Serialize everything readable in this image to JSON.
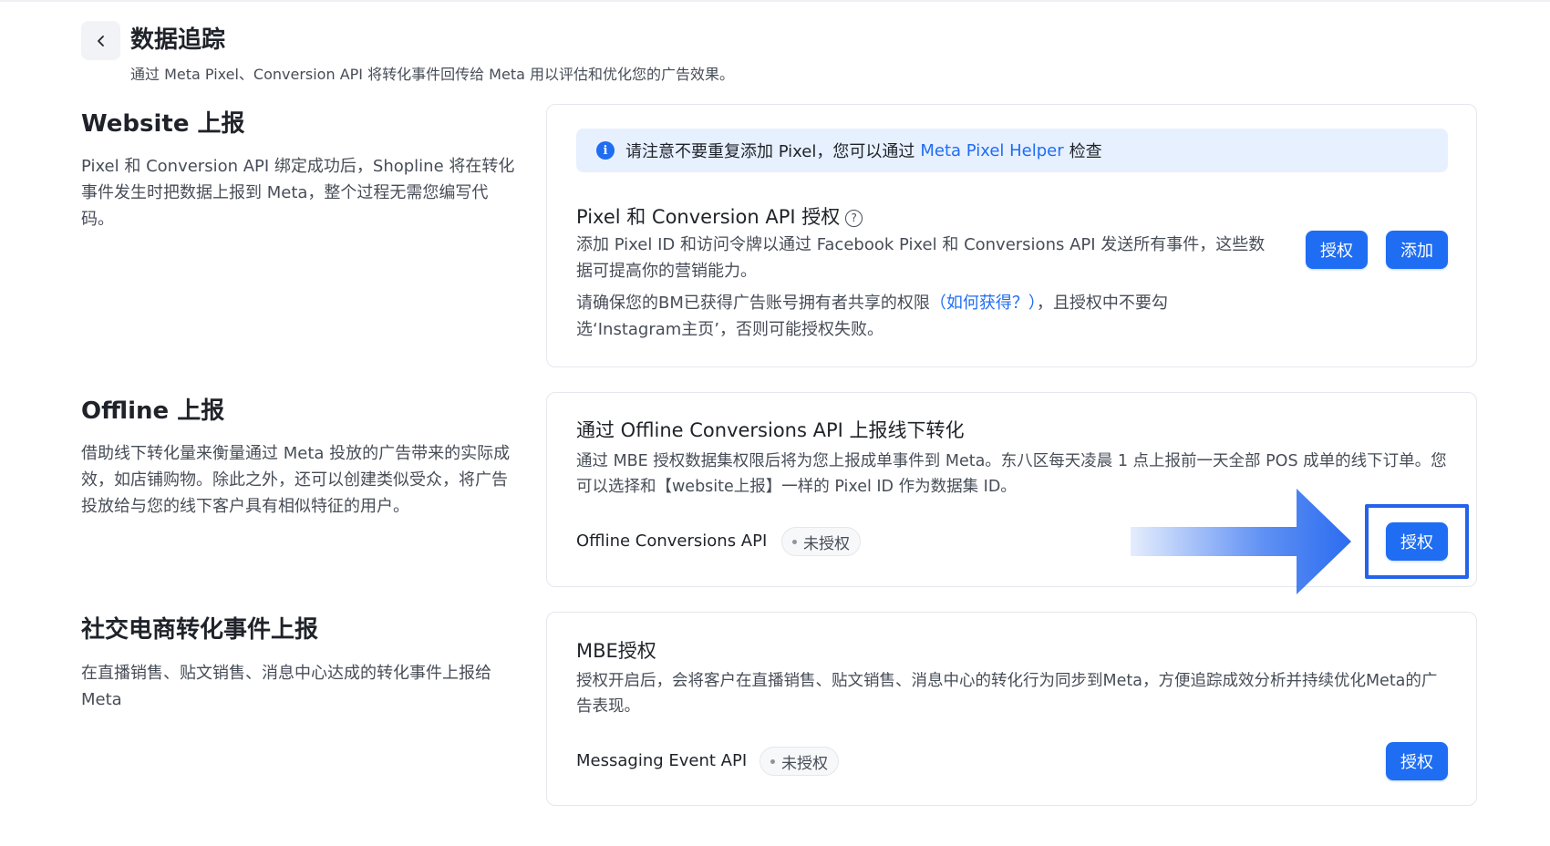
{
  "header": {
    "title": "数据追踪",
    "subtitle": "通过 Meta Pixel、Conversion API 将转化事件回传给 Meta 用以评估和优化您的广告效果。"
  },
  "website": {
    "title": "Website 上报",
    "description": "Pixel 和 Conversion API 绑定成功后，Shopline 将在转化事件发生时把数据上报到 Meta，整个过程无需您编写代码。",
    "notice_text": "请注意不要重复添加 Pixel，您可以通过",
    "notice_link": "Meta Pixel Helper",
    "notice_suffix": "检查",
    "card_title": "Pixel 和 Conversion API 授权",
    "card_desc": "添加 Pixel ID 和访问令牌以通过 Facebook Pixel 和 Conversions API 发送所有事件，这些数据可提高你的营销能力。",
    "warn_prefix": "请确保您的BM已获得广告账号拥有者共享的权限",
    "warn_link": "（如何获得？）",
    "warn_suffix": "，且授权中不要勾选‘Instagram主页’，否则可能授权失败。",
    "authorize_label": "授权",
    "add_label": "添加"
  },
  "offline": {
    "title": "Offline 上报",
    "description": "借助线下转化量来衡量通过 Meta 投放的广告带来的实际成效，如店铺购物。除此之外，还可以创建类似受众，将广告投放给与您的线下客户具有相似特征的用户。",
    "card_title": "通过 Offline Conversions API 上报线下转化",
    "card_desc": "通过 MBE 授权数据集权限后将为您上报成单事件到 Meta。东八区每天凌晨 1 点上报前一天全部 POS 成单的线下订单。您可以选择和【website上报】一样的 Pixel ID 作为数据集 ID。",
    "api_name": "Offline Conversions API",
    "status": "未授权",
    "authorize_label": "授权"
  },
  "social": {
    "title": "社交电商转化事件上报",
    "description": "在直播销售、贴文销售、消息中心达成的转化事件上报给 Meta",
    "card_title": "MBE授权",
    "card_desc": "授权开启后，会将客户在直播销售、贴文销售、消息中心的转化行为同步到Meta，方便追踪成效分析并持续优化Meta的广告表现。",
    "api_name": "Messaging Event API",
    "status": "未授权",
    "authorize_label": "授权"
  },
  "colors": {
    "accent": "#1f6df2",
    "notice_bg": "#e7f0ff",
    "annotation": "#2563eb"
  },
  "icons": {
    "back": "chevron-left-icon",
    "info": "info-icon",
    "help": "question-circle-icon",
    "annotation": "arrow-right-icon"
  }
}
